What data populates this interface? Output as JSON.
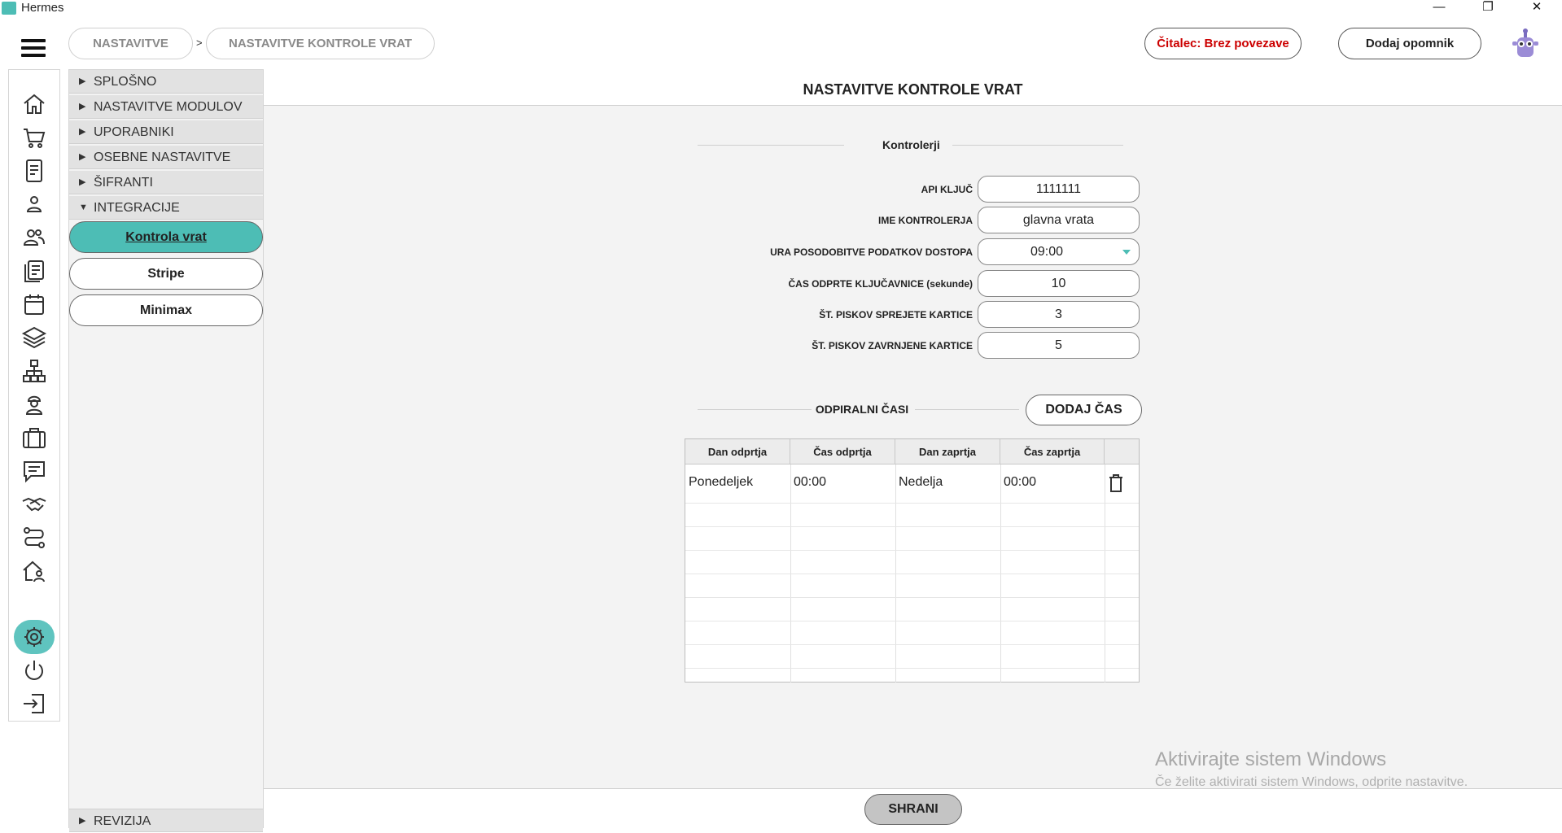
{
  "window": {
    "title": "Hermes",
    "min": "—",
    "max": "❐",
    "close": "✕"
  },
  "header": {
    "breadcrumbs": [
      "NASTAVITVE",
      "NASTAVITVE KONTROLE VRAT"
    ],
    "breadcrumb_sep": ">",
    "reader_status": "Čitalec: Brez povezave",
    "add_reminder": "Dodaj opomnik",
    "reader_status_color": "#cc0000"
  },
  "rail": {
    "icons": [
      "home-icon",
      "cart-icon",
      "document-icon",
      "user-icon",
      "users-icon",
      "records-icon",
      "calendar-icon",
      "layers-icon",
      "network-icon",
      "worker-icon",
      "briefcase-icon",
      "chat-icon",
      "handshake-icon",
      "route-icon",
      "house-icon",
      "gear-icon",
      "power-icon",
      "logout-icon"
    ],
    "active": "gear-icon",
    "accent": "#5fc4bf"
  },
  "nav": {
    "sections": [
      "SPLOŠNO",
      "NASTAVITVE MODULOV",
      "UPORABNIKI",
      "OSEBNE NASTAVITVE",
      "ŠIFRANTI",
      "INTEGRACIJE"
    ],
    "open_section": "INTEGRACIJE",
    "items": [
      "Kontrola vrat",
      "Stripe",
      "Minimax"
    ],
    "active_item": "Kontrola vrat",
    "bottom_section": "REVIZIJA"
  },
  "main": {
    "title": "NASTAVITVE KONTROLE VRAT",
    "controllers_section": "Kontrolerji",
    "fields": [
      {
        "label": "API KLJUČ",
        "value": "1111111"
      },
      {
        "label": "IME KONTROLERJA",
        "value": "glavna vrata"
      },
      {
        "label": "URA POSODOBITVE PODATKOV DOSTOPA",
        "value": "09:00"
      },
      {
        "label": "ČAS ODPRTE KLJUČAVNICE (sekunde)",
        "value": "10"
      },
      {
        "label": "ŠT. PISKOV SPREJETE KARTICE",
        "value": "3"
      },
      {
        "label": "ŠT. PISKOV ZAVRNJENE KARTICE",
        "value": "5"
      }
    ],
    "opening_section": "ODPIRALNI ČASI",
    "add_time": "DODAJ ČAS",
    "table": {
      "columns": [
        "Dan odprtja",
        "Čas odprtja",
        "Dan zaprtja",
        "Čas zaprtja",
        ""
      ],
      "rows": [
        [
          "Ponedeljek",
          "00:00",
          "Nedelja",
          "00:00"
        ]
      ]
    },
    "save": "SHRANI",
    "watermark_title": "Aktivirajte sistem Windows",
    "watermark_sub": "Če želite aktivirati sistem Windows, odprite nastavitve."
  }
}
